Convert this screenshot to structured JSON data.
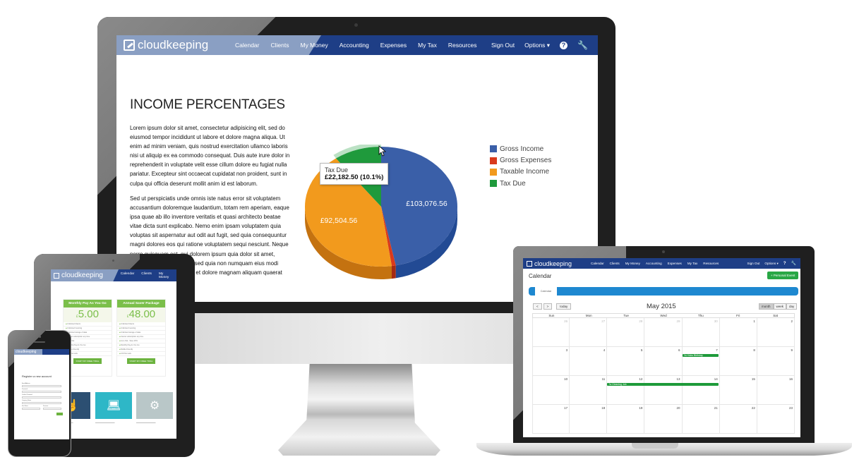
{
  "brand": {
    "name": "cloudkeeping",
    "nav_color": "#1e3e86",
    "logo_bg": "#8a9fc3"
  },
  "monitor": {
    "nav": {
      "items": [
        "Calendar",
        "Clients",
        "My Money",
        "Accounting",
        "Expenses",
        "My Tax",
        "Resources"
      ],
      "sign_out": "Sign Out",
      "options": "Options ▾",
      "help_icon": "?",
      "wrench_icon": "🔧"
    },
    "title": "INCOME PERCENTAGES",
    "paragraph1": "Lorem ipsum dolor sit amet, consectetur adipisicing elit, sed do eiusmod tempor incididunt ut labore et dolore magna aliqua. Ut enim ad minim veniam, quis nostrud exercitation ullamco laboris nisi ut aliquip ex ea commodo consequat. Duis aute irure dolor in reprehenderit in voluptate velit esse cillum dolore eu fugiat nulla pariatur. Excepteur sint occaecat cupidatat non proident, sunt in culpa qui officia deserunt mollit anim id est laborum.",
    "paragraph2": "Sed ut perspiciatis unde omnis iste natus error sit voluptatem accusantium doloremque laudantium, totam rem aperiam, eaque ipsa quae ab illo inventore veritatis et quasi architecto beatae vitae dicta sunt explicabo. Nemo enim ipsam voluptatem quia voluptas sit aspernatur aut odit aut fugit, sed quia consequuntur magni dolores eos qui ratione voluptatem sequi nesciunt. Neque porro quisquam est, qui dolorem ipsum quia dolor sit amet, consectetur, adipisci velit, sed quia non numquam eius modi tempora incidunt ut labore et dolore magnam aliquam quaerat",
    "tooltip": {
      "title": "Tax Due",
      "value": "£22,182.50 (10.1%)"
    }
  },
  "chart_data": {
    "type": "pie",
    "title": "INCOME PERCENTAGES",
    "style": "3d",
    "categories": [
      "Gross Income",
      "Gross Expenses",
      "Taxable Income",
      "Tax Due"
    ],
    "values": [
      103076.56,
      1865,
      92504.56,
      22182.5
    ],
    "colors": [
      "#3a5fa8",
      "#d93a1c",
      "#f29a1d",
      "#1f9a3c"
    ],
    "side_colors": [
      "#224a94",
      "#a52a14",
      "#c47210",
      "#177a2e"
    ],
    "data_labels": [
      "£103,076.56",
      "",
      "£92,504.56",
      ""
    ],
    "highlighted": "Tax Due",
    "legend_position": "right"
  },
  "laptop": {
    "nav": {
      "items": [
        "Calendar",
        "Clients",
        "My Money",
        "Accounting",
        "Expenses",
        "My Tax",
        "Resources"
      ],
      "sign_out": "Sign Out",
      "options": "Options ▾"
    },
    "page_title": "Calendar",
    "add_button": "+ Personal Event",
    "tab": "Calendar",
    "prev": "<",
    "next": ">",
    "today": "today",
    "month": "May 2015",
    "views": [
      "month",
      "week",
      "day"
    ],
    "active_view": "month",
    "weekdays": [
      "Sun",
      "Mon",
      "Tue",
      "Wed",
      "Thu",
      "Fri",
      "Sat"
    ],
    "weeks": [
      [
        {
          "d": "26",
          "o": true
        },
        {
          "d": "27",
          "o": true
        },
        {
          "d": "28",
          "o": true
        },
        {
          "d": "29",
          "o": true
        },
        {
          "d": "30",
          "o": true
        },
        {
          "d": "1"
        },
        {
          "d": "2"
        }
      ],
      [
        {
          "d": "3"
        },
        {
          "d": "4"
        },
        {
          "d": "5"
        },
        {
          "d": "6"
        },
        {
          "d": "7"
        },
        {
          "d": "8"
        },
        {
          "d": "9"
        }
      ],
      [
        {
          "d": "10"
        },
        {
          "d": "11"
        },
        {
          "d": "12"
        },
        {
          "d": "13"
        },
        {
          "d": "14"
        },
        {
          "d": "15"
        },
        {
          "d": "16"
        }
      ],
      [
        {
          "d": "17"
        },
        {
          "d": "18"
        },
        {
          "d": "19"
        },
        {
          "d": "20"
        },
        {
          "d": "21"
        },
        {
          "d": "22"
        },
        {
          "d": "23"
        }
      ]
    ],
    "events": [
      {
        "label": "7a Hicks Birthday",
        "week": 1,
        "start": 4,
        "span": 1
      },
      {
        "label": "7a Cleaning Job",
        "week": 2,
        "start": 2,
        "span": 3
      }
    ]
  },
  "tablet": {
    "nav": {
      "items": [
        "Calendar",
        "Clients",
        "My Money"
      ]
    },
    "plans": [
      {
        "name": "Monthly Pay As You Go",
        "price": "5.00",
        "currency": "£",
        "button": "START MY FREE TRIAL",
        "features": [
          "Unlimited Clients",
          "Unlimited Invoicing",
          "Unlimited storage of data",
          "Cancel subscription any time",
          "Live chat",
          "Monthly Pay As You Go",
          "Mobile Friendly",
          "CIS Tax tools"
        ]
      },
      {
        "name": "Annual Saver Package",
        "price": "48.00",
        "currency": "£",
        "button": "START MY FREE TRIAL",
        "features": [
          "Unlimited Clients",
          "Unlimited Invoicing",
          "Unlimited storage of data",
          "Cancel subscription any time",
          "Live chat - Save 20%",
          "Monthly Pay As You Go",
          "Mobile Friendly",
          "CIS Tax tools"
        ]
      }
    ],
    "tiles": [
      "hand-pointer-icon",
      "laptop-icon",
      "gears-icon"
    ]
  },
  "phone": {
    "title": "Register a new account",
    "fields": [
      "Email Address",
      "Password",
      "Confirm Password",
      "Company Name",
      "First Name",
      "Surname"
    ]
  }
}
